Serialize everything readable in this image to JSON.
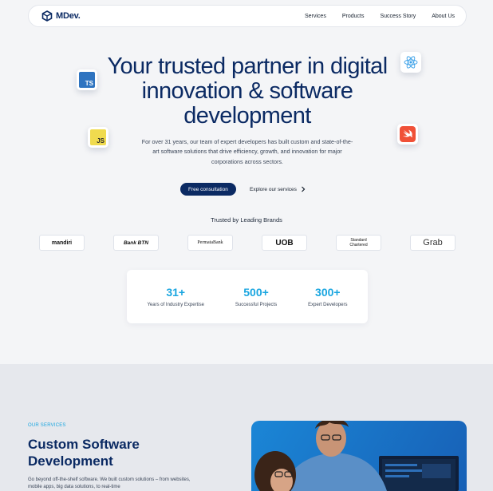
{
  "nav": {
    "brand": "MDev.",
    "links": [
      "Services",
      "Products",
      "Success Story",
      "About Us"
    ]
  },
  "hero": {
    "title": "Your trusted partner in digital innovation & software development",
    "subtitle": "For over 31 years, our team of expert developers has built custom and state-of-the-art software solutions that drive efficiency, growth, and innovation for major corporations across sectors.",
    "cta_primary": "Free consultation",
    "cta_secondary": "Explore our services"
  },
  "tech_logos": {
    "ts": "TS",
    "js": "JS",
    "react": "react-icon",
    "swift": "swift-icon"
  },
  "trusted": {
    "heading": "Trusted by Leading Brands",
    "brands": [
      "mandiri",
      "Bank BTN",
      "PermataBank",
      "UOB",
      "Standard Chartered",
      "Grab"
    ]
  },
  "stats": [
    {
      "num": "31+",
      "label": "Years of Industry Expertise"
    },
    {
      "num": "500+",
      "label": "Successful Projects"
    },
    {
      "num": "300+",
      "label": "Expert Developers"
    }
  ],
  "services": {
    "eyebrow": "OUR SERVICES",
    "title": "Custom Software Development",
    "desc": "Go beyond off-the-shelf software. We built custom solutions – from websites, mobile apps, big data solutions, to real-time"
  },
  "colors": {
    "navy": "#0b2a63",
    "accent": "#1aa6e0",
    "bg": "#f4f5f7"
  }
}
